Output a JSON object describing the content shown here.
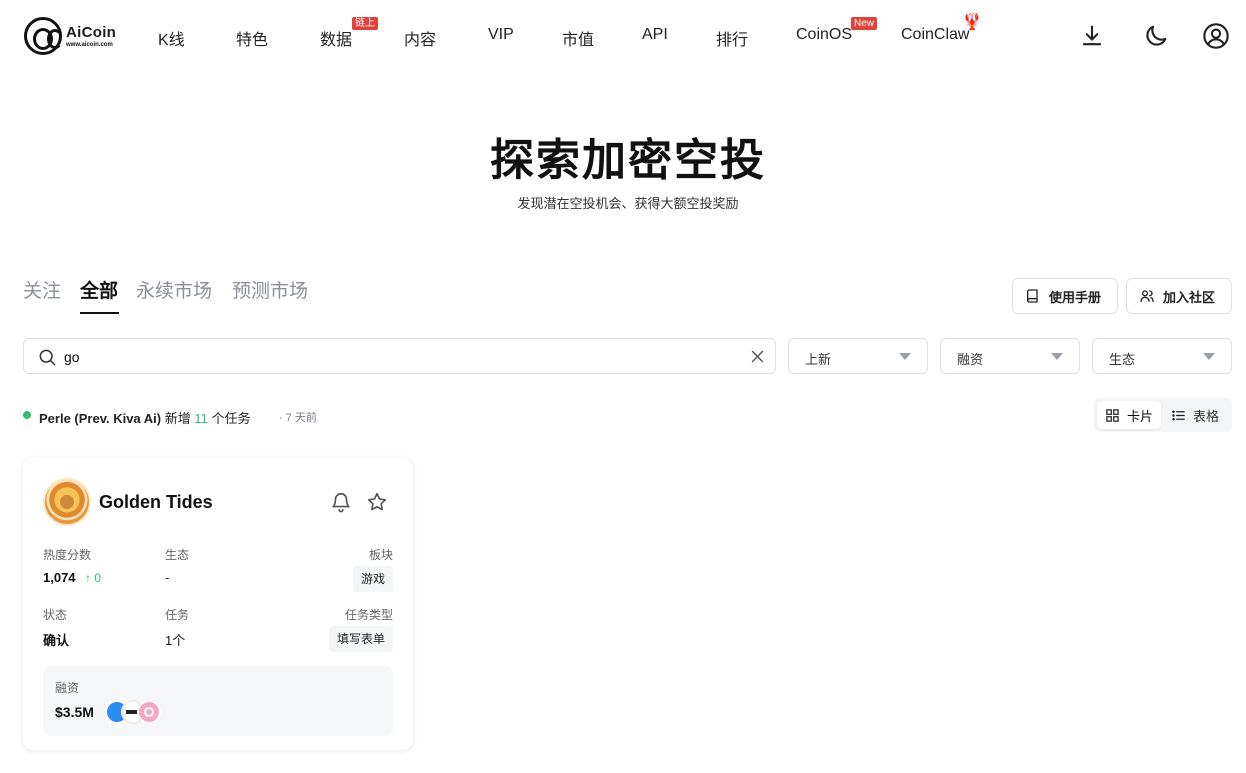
{
  "logo": {
    "name": "AiCoin",
    "url": "www.aicoin.com"
  },
  "nav": {
    "items": [
      {
        "label": "K线"
      },
      {
        "label": "特色"
      },
      {
        "label": "数据",
        "badge": "链上"
      },
      {
        "label": "内容"
      },
      {
        "label": "VIP"
      },
      {
        "label": "市值"
      },
      {
        "label": "API"
      },
      {
        "label": "排行"
      },
      {
        "label": "CoinOS",
        "badge": "New"
      },
      {
        "label": "CoinClaw"
      }
    ],
    "icons": [
      "download-icon",
      "moon-icon",
      "user-icon"
    ]
  },
  "hero": {
    "title": "探索加密空投",
    "subtitle": "发现潜在空投机会、获得大额空投奖励"
  },
  "tabs": [
    {
      "label": "关注",
      "active": false
    },
    {
      "label": "全部",
      "active": true
    },
    {
      "label": "永续市场",
      "active": false
    },
    {
      "label": "预测市场",
      "active": false
    }
  ],
  "actions": {
    "manual": "使用手册",
    "community": "加入社区"
  },
  "search": {
    "value": "go",
    "placeholder": ""
  },
  "filters": [
    {
      "label": "上新"
    },
    {
      "label": "融资"
    },
    {
      "label": "生态"
    }
  ],
  "update": {
    "project": "Perle (Prev. Kiva Ai)",
    "prefix": "新增",
    "count": "11",
    "suffix": "个任务",
    "time": "· 7 天前"
  },
  "view": {
    "card": "卡片",
    "table": "表格",
    "active": "card"
  },
  "cards": [
    {
      "name": "Golden Tides",
      "heat_label": "热度分数",
      "heat_value": "1,074",
      "heat_delta": "↑ 0",
      "eco_label": "生态",
      "eco_value": "-",
      "sector_label": "板块",
      "sector_value": "游戏",
      "status_label": "状态",
      "status_value": "确认",
      "task_label": "任务",
      "task_value": "1个",
      "task_type_label": "任务类型",
      "task_type_value": "填写表单",
      "funding_label": "融资",
      "funding_value": "$3.5M"
    }
  ],
  "colors": {
    "accent_green": "#2fbf71",
    "badge_red": "#e0423a"
  }
}
